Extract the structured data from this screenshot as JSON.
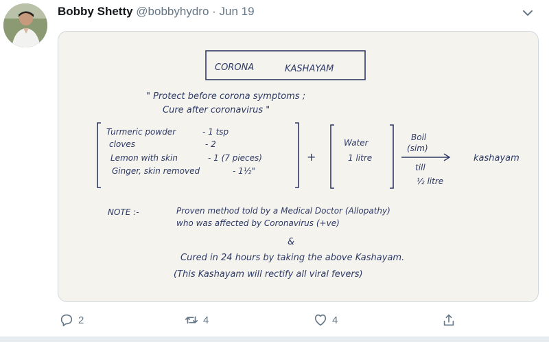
{
  "tweet": {
    "author_name": "Bobby Shetty",
    "handle": "@bobbyhydro",
    "separator": "·",
    "date": "Jun 19"
  },
  "note": {
    "title_left": "CORONA",
    "title_right": "KASHAYAM",
    "quote_line1": "\" Protect before corona symptoms ;",
    "quote_line2": "Cure after coronavirus \"",
    "ingredients": [
      {
        "name": "Turmeric powder",
        "qty": "- 1 tsp"
      },
      {
        "name": "cloves",
        "qty": "- 2"
      },
      {
        "name": "Lemon with skin",
        "qty": "- 1 (7 pieces)"
      },
      {
        "name": "Ginger, skin removed",
        "qty": "- 1½\""
      }
    ],
    "plus": "+",
    "water_label": "Water",
    "water_qty": "1 litre",
    "boil_line1": "Boil",
    "boil_line2": "(sim)",
    "till_line1": "till",
    "till_line2": "½ litre",
    "result": "kashayam",
    "note_label": "NOTE :-",
    "note_line1": "Proven method told by a Medical Doctor (Allopathy)",
    "note_line2": "who was affected by   Coronavirus (+ve)",
    "ampersand": "&",
    "cured_line": "Cured in 24 hours by taking the above Kashayam.",
    "viral_line": "(This Kashayam will rectify all viral fevers)"
  },
  "actions": {
    "reply_count": "2",
    "retweet_count": "4",
    "like_count": "4"
  },
  "colors": {
    "ink": "#2e3a66",
    "muted": "#657786",
    "paper": "#f4f3ee"
  }
}
